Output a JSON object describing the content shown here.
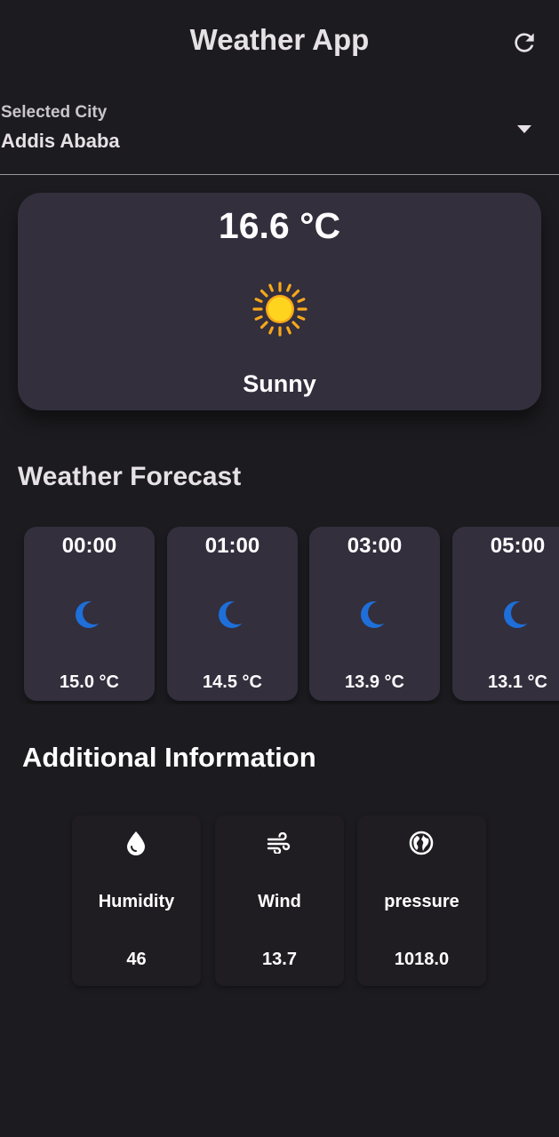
{
  "app_bar": {
    "title": "Weather App",
    "refresh_icon": "refresh-icon"
  },
  "city_select": {
    "label": "Selected City",
    "value": "Addis Ababa",
    "arrow_icon": "dropdown-arrow-icon"
  },
  "current": {
    "temperature": "16.6 °C",
    "condition": "Sunny",
    "icon": "sun-icon"
  },
  "forecast": {
    "title": "Weather Forecast",
    "items": [
      {
        "time": "00:00",
        "icon": "moon-icon",
        "temp": "15.0 °C"
      },
      {
        "time": "01:00",
        "icon": "moon-icon",
        "temp": "14.5 °C"
      },
      {
        "time": "03:00",
        "icon": "moon-icon",
        "temp": "13.9 °C"
      },
      {
        "time": "05:00",
        "icon": "moon-icon",
        "temp": "13.1 °C"
      }
    ]
  },
  "additional": {
    "title": "Additional Information",
    "items": [
      {
        "label": "Humidity",
        "value": "46",
        "icon": "water-drop-icon"
      },
      {
        "label": "Wind",
        "value": "13.7",
        "icon": "wind-icon"
      },
      {
        "label": "pressure",
        "value": "1018.0",
        "icon": "globe-icon"
      }
    ]
  },
  "colors": {
    "background": "#1c1b1f",
    "card": "#332f3d",
    "info_card": "#1f1d22",
    "sun": "#f9c21b",
    "moon": "#1e6fd9"
  }
}
